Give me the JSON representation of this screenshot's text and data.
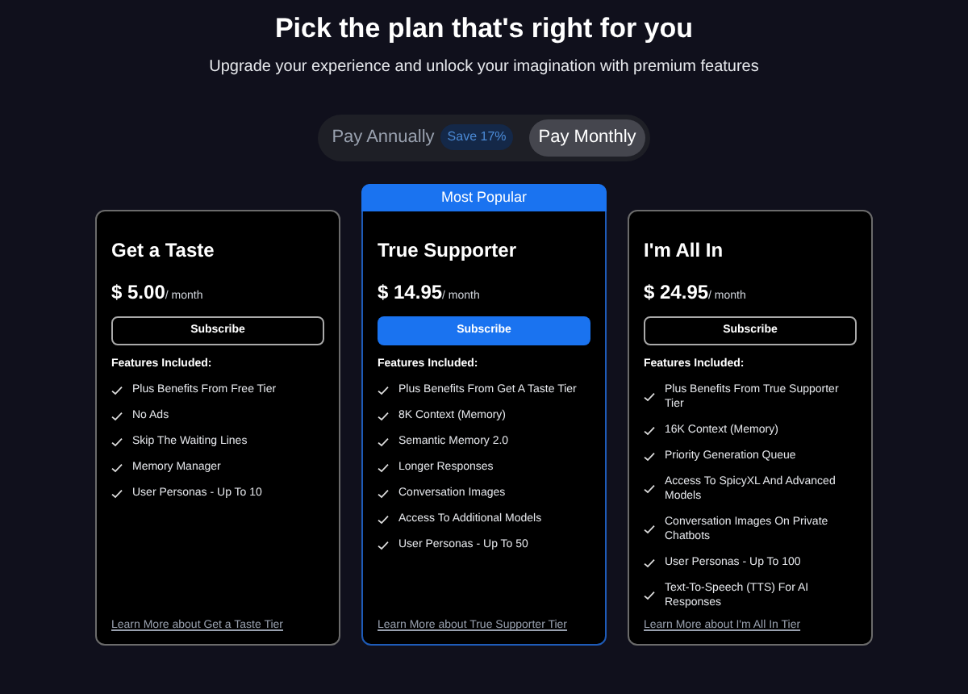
{
  "heading": "Pick the plan that's right for you",
  "subheading": "Upgrade your experience and unlock your imagination with premium features",
  "billing_toggle": [
    {
      "label": "Pay Annually",
      "badge": "Save 17%",
      "selected": false
    },
    {
      "label": "Pay Monthly",
      "selected": true
    }
  ],
  "plans": [
    {
      "name": "Get a Taste",
      "price": "$ 5.00",
      "period": "/ month",
      "button": "Subscribe",
      "highlighted": false,
      "features_title": "Features Included:",
      "features": [
        "Plus Benefits From Free Tier",
        "No Ads",
        "Skip The Waiting Lines",
        "Memory Manager",
        "User Personas - Up To 10"
      ],
      "link": "Learn More about Get a Taste Tier"
    },
    {
      "name": "True Supporter",
      "ribbon": "Most Popular",
      "price": "$ 14.95",
      "period": "/ month",
      "button": "Subscribe",
      "highlighted": true,
      "features_title": "Features Included:",
      "features": [
        "Plus Benefits From Get A Taste Tier",
        "8K Context (Memory)",
        "Semantic Memory 2.0",
        "Longer Responses",
        "Conversation Images",
        "Access To Additional Models",
        "User Personas - Up To 50"
      ],
      "link": "Learn More about True Supporter Tier"
    },
    {
      "name": "I'm All In",
      "price": "$ 24.95",
      "period": "/ month",
      "button": "Subscribe",
      "highlighted": false,
      "features_title": "Features Included:",
      "features": [
        "Plus Benefits From True Supporter Tier",
        "16K Context (Memory)",
        "Priority Generation Queue",
        "Access To SpicyXL And Advanced Models",
        "Conversation Images On Private Chatbots",
        "User Personas - Up To 100",
        "Text-To-Speech (TTS) For AI Responses"
      ],
      "link": "Learn More about I'm All In Tier"
    }
  ]
}
